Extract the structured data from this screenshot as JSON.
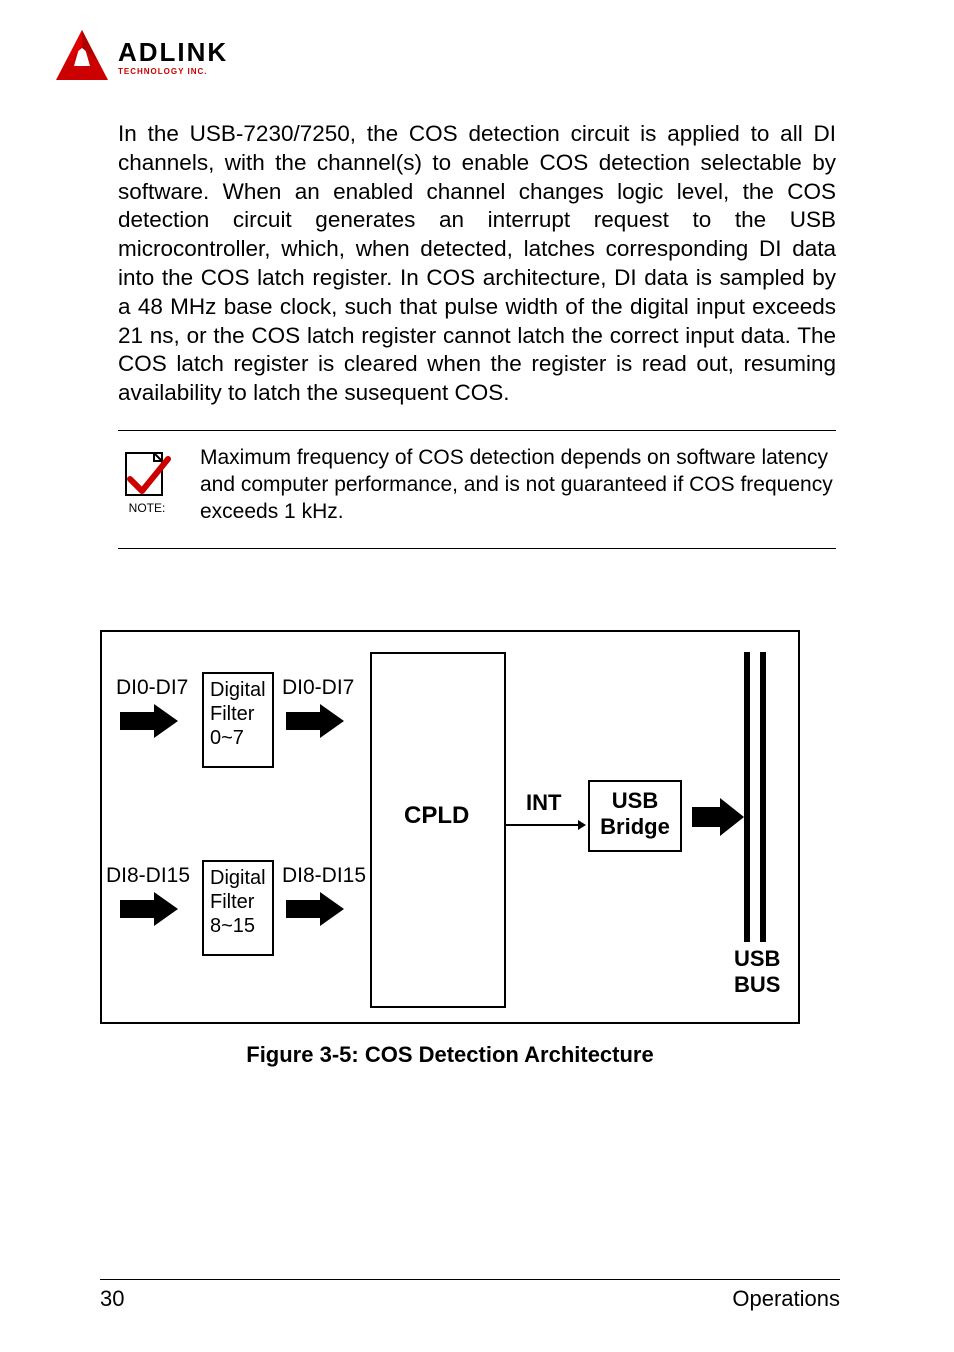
{
  "logo": {
    "main": "ADLINK",
    "sub": "TECHNOLOGY INC."
  },
  "paragraph": "In the USB-7230/7250, the COS detection circuit is applied to all DI channels, with the channel(s) to enable COS detection selectable by software. When an enabled channel changes logic level, the COS detection circuit generates an interrupt request to the USB microcontroller, which, when detected, latches corresponding DI data into the COS latch register. In COS architecture, DI data is sampled by a 48 MHz base clock, such that pulse width of the digital input exceeds 21 ns, or the COS latch register cannot latch the correct input data. The COS latch register is cleared when the register is read out, resuming availability to latch the susequent COS.",
  "note": {
    "label": "NOTE:",
    "text": "Maximum frequency of COS detection depends on software latency and computer performance, and is not guaranteed if COS frequency exceeds 1 kHz."
  },
  "diagram": {
    "di0_7": "DI0-DI7",
    "di8_15": "DI8-DI15",
    "filter_0_7_l1": "Digital",
    "filter_0_7_l2": "Filter",
    "filter_0_7_l3": "0~7",
    "filter_8_15_l1": "Digital",
    "filter_8_15_l2": "Filter",
    "filter_8_15_l3": "8~15",
    "cpld": "CPLD",
    "int": "INT",
    "usb_bridge_l1": "USB",
    "usb_bridge_l2": "Bridge",
    "usb_bus_l1": "USB",
    "usb_bus_l2": "BUS"
  },
  "figure_caption": "Figure 3-5: COS Detection Architecture",
  "footer": {
    "page": "30",
    "section": "Operations"
  }
}
